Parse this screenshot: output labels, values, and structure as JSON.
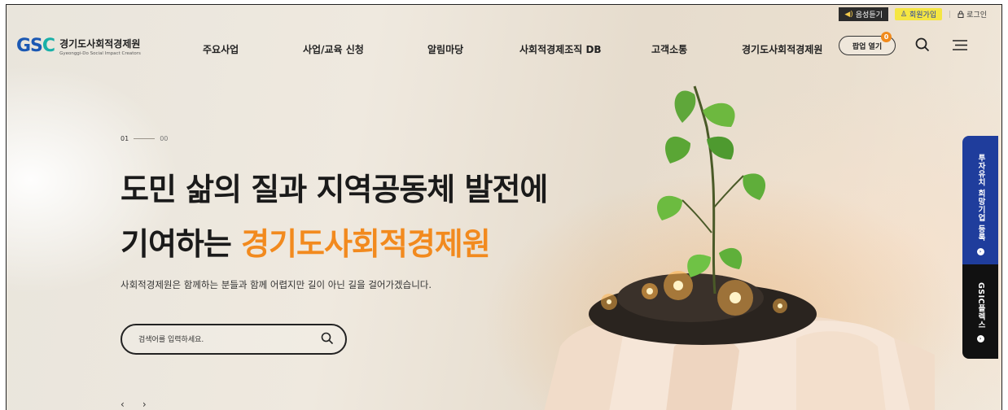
{
  "util_bar": {
    "voice_label": "음성듣기",
    "join_label": "회원가입",
    "separator": "|",
    "login_label": "로그인"
  },
  "header": {
    "logo_mark": "GS",
    "logo_mark_c": "C",
    "logo_title": "경기도사회적경제원",
    "logo_subtitle": "Gyeonggi-Do Social Impact Creators",
    "nav": [
      "주요사업",
      "사업/교육 신청",
      "알림마당",
      "사회적경제조직 DB",
      "고객소통",
      "경기도사회적경제원"
    ],
    "popup_label": "팝업 열기",
    "popup_count": "0"
  },
  "hero": {
    "page_current": "01",
    "page_total": "00",
    "title_line1": "도민 삶의 질과 지역공동체 발전에",
    "title_line2_prefix": "기여하는 ",
    "title_line2_highlight": "경기도사회적경제원",
    "subtitle": "사회적경제원은 함께하는 분들과 함께 어렵지만 길이 아닌 길을 걸어가겠습니다.",
    "search_placeholder": "검색어를 입력하세요.",
    "prev_arrow": "‹",
    "next_arrow": "›"
  },
  "side_tabs": {
    "tab1": "투자유치 희망기업 등록",
    "tab2": "GSIC플렉스"
  },
  "colors": {
    "brand_blue": "#1b58b3",
    "brand_teal": "#19b0a8",
    "accent_orange": "#f28a1e",
    "side_blue": "#1f3d9c",
    "join_yellow": "#f5e642"
  }
}
